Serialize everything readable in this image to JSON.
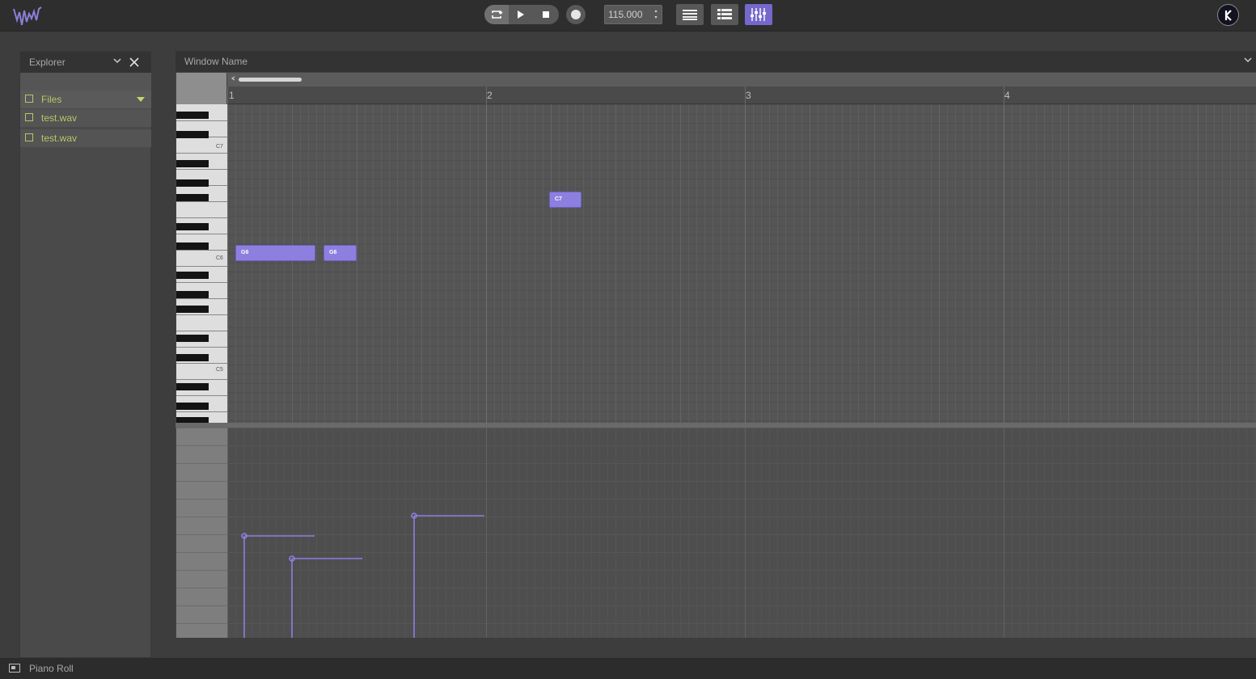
{
  "toolbar": {
    "bpm": "115.000",
    "stepper": {
      "up": "▴",
      "down": "▾"
    },
    "accent": "#7568cc"
  },
  "explorer": {
    "title": "Explorer",
    "tree": [
      {
        "label": "Files",
        "type": "folder"
      },
      {
        "label": "test.wav",
        "type": "file"
      },
      {
        "label": "test.wav",
        "type": "file"
      }
    ]
  },
  "piano_roll": {
    "window_title": "Window Name",
    "bars": [
      "1",
      "2",
      "3",
      "4"
    ],
    "octave_labels": [
      "C7",
      "C6",
      "C5"
    ],
    "notes": [
      {
        "label": "C7"
      },
      {
        "label": "G6"
      },
      {
        "label": "G6"
      }
    ]
  },
  "statusbar": {
    "label": "Piano Roll"
  }
}
